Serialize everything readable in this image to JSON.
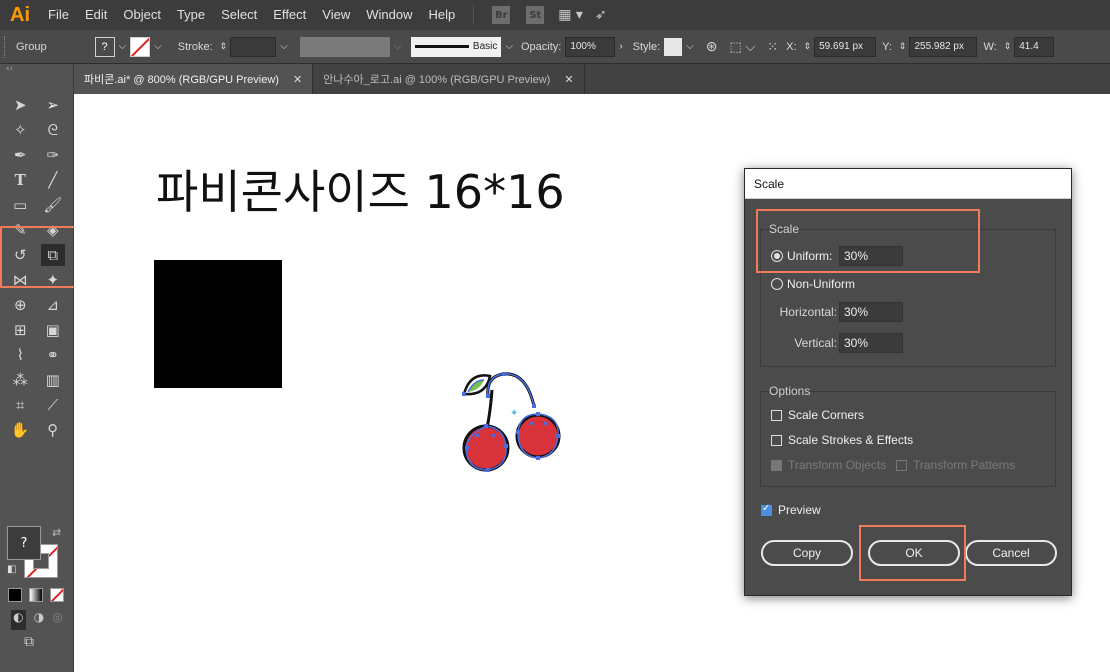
{
  "app": {
    "logo": "Ai"
  },
  "menu": [
    "File",
    "Edit",
    "Object",
    "Type",
    "Select",
    "Effect",
    "View",
    "Window",
    "Help"
  ],
  "menu_badges": [
    "Br",
    "St"
  ],
  "control_bar": {
    "selection_label": "Group",
    "stroke_label": "Stroke:",
    "brush_label": "Basic",
    "opacity_label": "Opacity:",
    "opacity_value": "100%",
    "style_label": "Style:",
    "x_label": "X:",
    "x_value": "59.691 px",
    "y_label": "Y:",
    "y_value": "255.982 px",
    "w_label": "W:",
    "w_value": "41.4"
  },
  "tabs": [
    {
      "label": "파비콘.ai* @ 800% (RGB/GPU Preview)",
      "close": "✕",
      "active": true
    },
    {
      "label": "안나수아_로고.ai @ 100% (RGB/GPU Preview)",
      "close": "✕",
      "active": false
    }
  ],
  "canvas": {
    "title": "파비콘사이즈 16*16"
  },
  "fill_stroke": {
    "fill_symbol": "?"
  },
  "dialog": {
    "title": "Scale",
    "scale_group_label": "Scale",
    "uniform_label": "Uniform:",
    "uniform_value": "30%",
    "non_uniform_label": "Non-Uniform",
    "horizontal_label": "Horizontal:",
    "horizontal_value": "30%",
    "vertical_label": "Vertical:",
    "vertical_value": "30%",
    "options_label": "Options",
    "scale_corners_label": "Scale Corners",
    "scale_strokes_label": "Scale Strokes & Effects",
    "transform_objects_label": "Transform Objects",
    "transform_patterns_label": "Transform Patterns",
    "preview_label": "Preview",
    "copy_label": "Copy",
    "ok_label": "OK",
    "cancel_label": "Cancel"
  },
  "colors": {
    "highlight": "#f07a5a",
    "app_logo": "#ff9a00",
    "selection_blue": "#4a6ee0",
    "cherry_red": "#d8333a"
  }
}
